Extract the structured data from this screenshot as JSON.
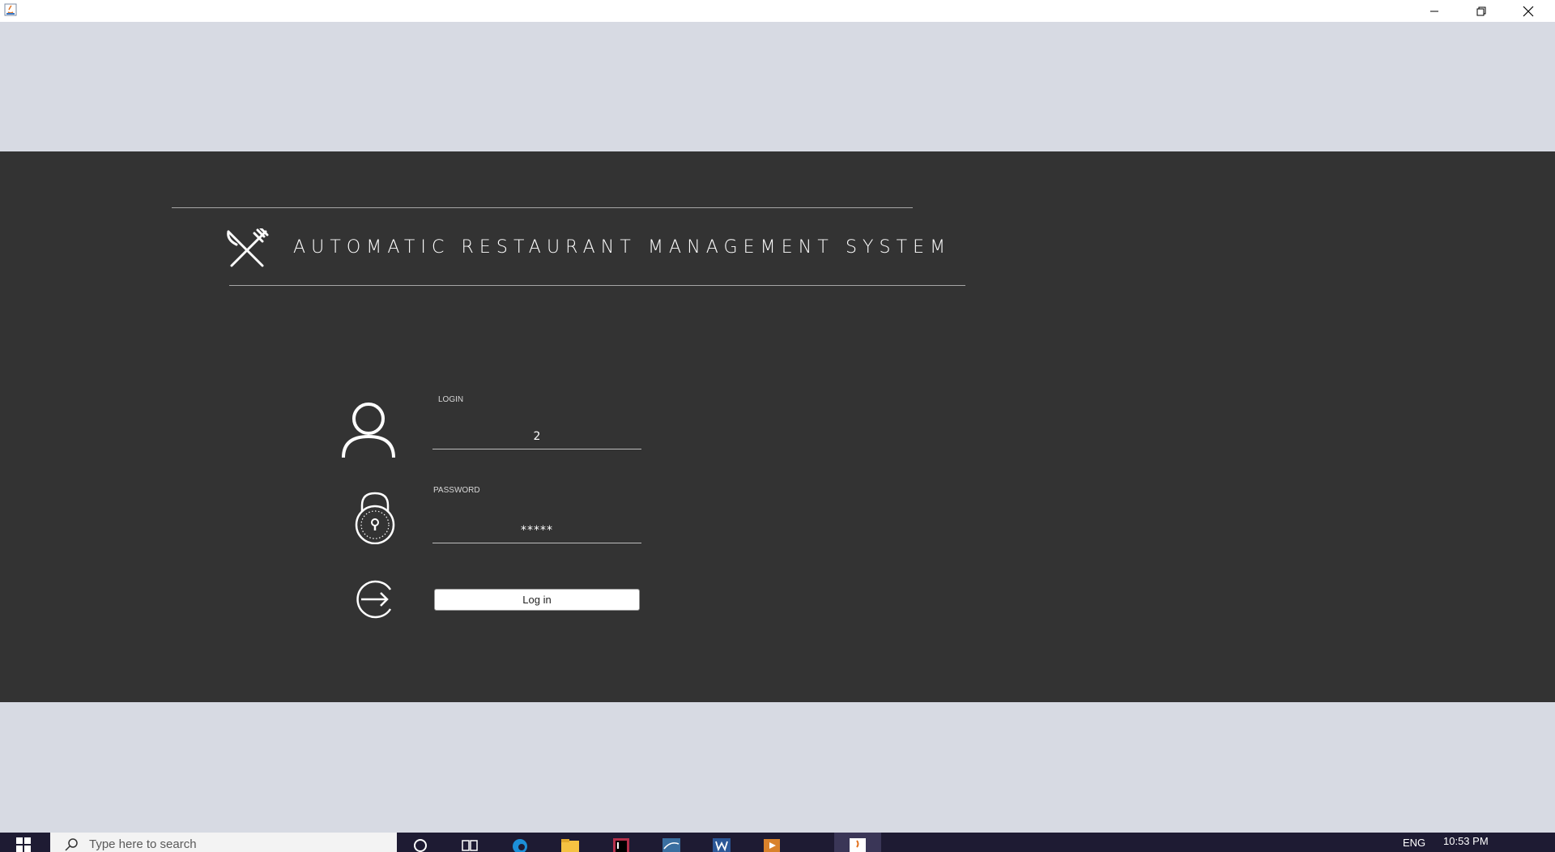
{
  "app": {
    "title": "AUTOMATIC RESTAURANT MANAGEMENT SYSTEM"
  },
  "form": {
    "login_label": "LOGIN",
    "login_value": "2",
    "password_label": "PASSWORD",
    "password_value": "*****",
    "login_button": "Log in"
  },
  "taskbar": {
    "search_placeholder": "Type here to search",
    "language": "ENG",
    "clock": "10:53 PM"
  },
  "colors": {
    "panel": "#333333",
    "background": "#d7dae3",
    "taskbar": "#1e1b33"
  },
  "icons": [
    "java-app-icon",
    "minimize-icon",
    "maximize-icon",
    "close-icon",
    "fork-knife-icon",
    "user-icon",
    "lock-icon",
    "login-arrow-icon",
    "windows-start-icon",
    "search-icon",
    "cortana-icon",
    "task-view-icon",
    "edge-icon",
    "file-explorer-icon",
    "intellij-icon",
    "mysql-icon",
    "word-icon",
    "media-player-icon",
    "java-taskbar-icon"
  ]
}
